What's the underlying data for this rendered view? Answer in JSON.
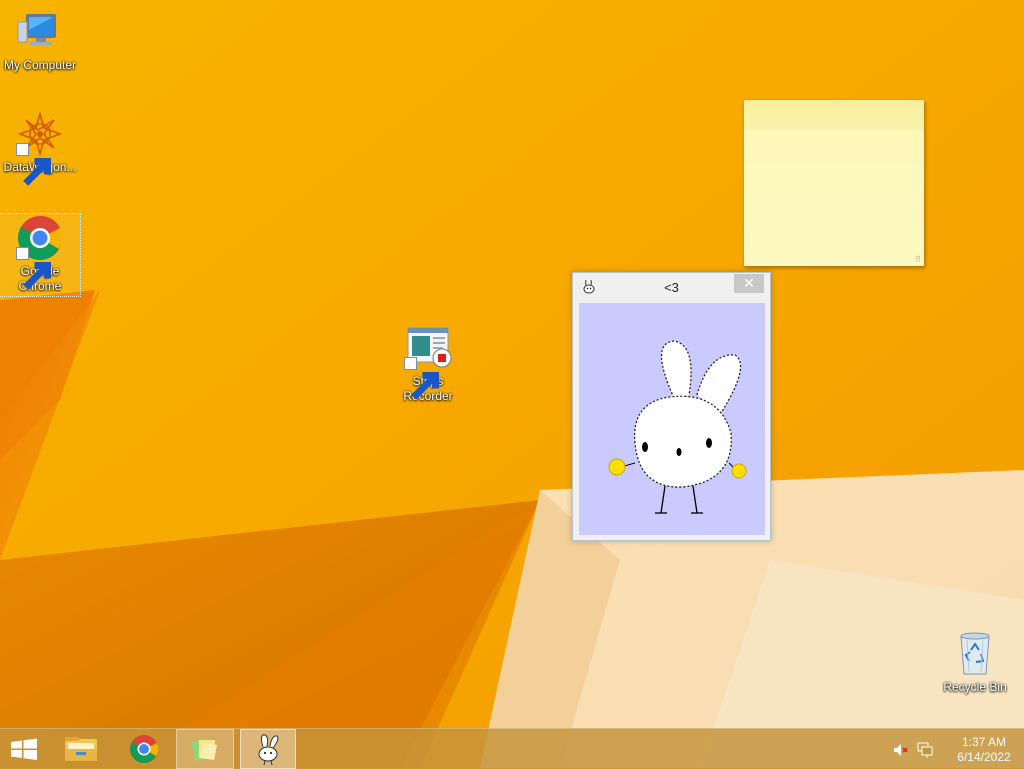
{
  "desktop": {
    "icons": [
      {
        "label": "My Computer",
        "icon": "computer-icon"
      },
      {
        "label": "DataWagon...",
        "icon": "datawagon-icon"
      },
      {
        "label": "Google Chrome",
        "icon": "chrome-icon"
      },
      {
        "label": "Steps Recorder",
        "icon": "steps-recorder-icon"
      },
      {
        "label": "Recycle Bin",
        "icon": "recycle-bin-icon"
      }
    ]
  },
  "pet_window": {
    "title": "<3",
    "close_label": "✕"
  },
  "taskbar": {
    "items": [
      "start-icon",
      "file-explorer-icon",
      "chrome-icon",
      "sticky-notes-icon",
      "desktop-pet-icon"
    ],
    "clock": {
      "time": "1:37 AM",
      "date": "6/14/2022"
    },
    "tray": [
      "volume-muted-icon",
      "network-icon"
    ]
  },
  "colors": {
    "wallpaper": "#f5a800",
    "pet_background": "#cacaff",
    "sticky_note": "#fdf7b8"
  }
}
